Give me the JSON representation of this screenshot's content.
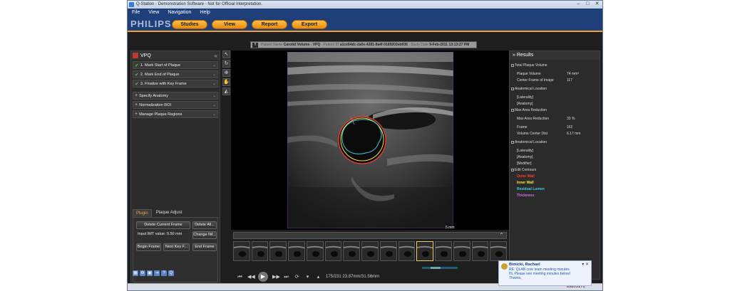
{
  "window": {
    "title": "Q-Station - Demonstration Software - Not for Official Interpretation."
  },
  "menu": [
    "File",
    "View",
    "Navigation",
    "Help"
  ],
  "brand": {
    "logo": "PHILIPS"
  },
  "nav_tabs": [
    "Studies",
    "View",
    "Report",
    "Export"
  ],
  "patient_bar": {
    "name_label": "Patient Name",
    "name": "Carotid Volume - VPQ",
    "id_label": "Patient ID",
    "id": "a1ce64dc-2a0e-4281-9a4f-0189203eb936",
    "date_label": "Study Date",
    "date": "9-Feb-2011 13:13:27 PM"
  },
  "left_panel": {
    "title": "VPQ",
    "steps": [
      {
        "label": "1. Mark Start of Plaque",
        "done": true
      },
      {
        "label": "2. Mark End of Plaque",
        "done": true
      },
      {
        "label": "3. Finalize with Key Frame",
        "done": true
      }
    ],
    "sections": [
      "Specify Anatomy",
      "Normalization ROI",
      "Manage Plaque Regions"
    ]
  },
  "plugin": {
    "tabs": [
      "Plugin",
      "Plaque Adjust"
    ],
    "delete_current": "Delete Current Frame",
    "delete_all": "Delete All...",
    "imt_label": "Input IMT value: 0.50 mm",
    "change_imt": "Change IM...",
    "begin_frame": "Begin Frame",
    "next_key": "Next Key F...",
    "end_frame": "End Frame"
  },
  "viewer": {
    "scale_label": "5 mm"
  },
  "player": {
    "frame_readout": "175/231  23.87mm/31.56mm"
  },
  "results": {
    "title": "Results",
    "rows": [
      {
        "k": "Total Plaque Volume",
        "v": "",
        "box": true
      },
      {
        "k": "Plaque Volume",
        "v": "74 mm³"
      },
      {
        "k": "Center Frame of Image",
        "v": "117"
      },
      {
        "k": "Anatomical Location",
        "v": "",
        "box": true
      },
      {
        "k": "[Laterality]",
        "v": ""
      },
      {
        "k": "[Anatomy]",
        "v": ""
      },
      {
        "k": "Max Area Reduction",
        "v": "",
        "box": true
      },
      {
        "k": "Max Area Reduction",
        "v": "33 %"
      },
      {
        "k": "Frame",
        "v": "162"
      },
      {
        "k": "Volume Center Dist",
        "v": "6.17 mm"
      },
      {
        "k": "Anatomical Location",
        "v": "",
        "box": true
      },
      {
        "k": "[Laterality]",
        "v": ""
      },
      {
        "k": "[Anatomy]",
        "v": ""
      },
      {
        "k": "[Modifier]",
        "v": ""
      },
      {
        "k": "Edit Contours",
        "v": "",
        "box": true
      }
    ],
    "legend": [
      {
        "label": "Outer Wall",
        "color": "#ff3b2f"
      },
      {
        "label": "Inner Wall",
        "color": "#f5e642"
      },
      {
        "label": "Residual Lumen",
        "color": "#3fd0e0"
      },
      {
        "label": "Thickness",
        "color": "#d06be0"
      }
    ]
  },
  "notification": {
    "from": "Bimicki, Rachael",
    "subject": "RE: QLAB core team meeting minutes",
    "body1": "Hi, Please see meeting minutes below!",
    "body2": "Thanks,"
  },
  "status": {
    "user": "usd05172"
  },
  "colors": {
    "accent": "#f0a030",
    "menubar": "#1f3f7a"
  }
}
